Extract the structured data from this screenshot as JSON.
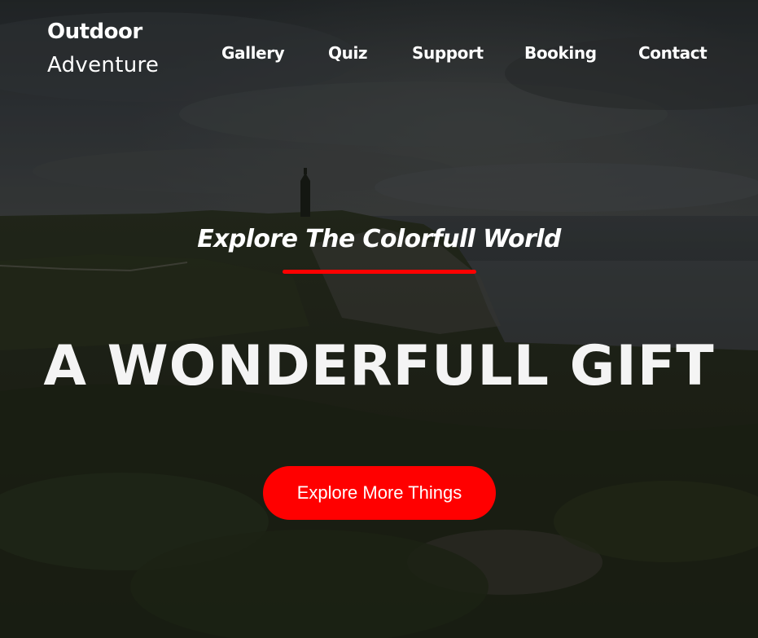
{
  "brand": {
    "line1": "Outdoor",
    "line2": "Adventure"
  },
  "nav": {
    "items": [
      {
        "label": "Gallery"
      },
      {
        "label": "Quiz"
      },
      {
        "label": "Support"
      },
      {
        "label": "Booking"
      },
      {
        "label": "Contact"
      }
    ]
  },
  "hero": {
    "subtitle": "Explore The Colorfull World",
    "headline": "A WONDERFULL GIFT",
    "cta_label": "Explore More Things"
  },
  "colors": {
    "accent": "#ff0000",
    "text": "#ffffff"
  }
}
